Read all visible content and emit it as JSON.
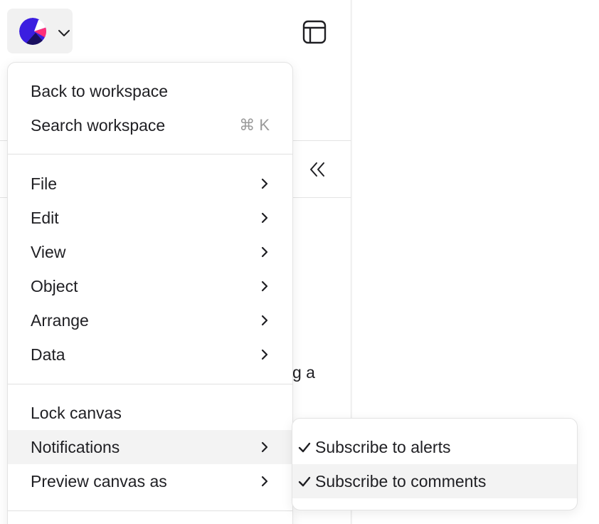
{
  "header": {
    "logo_icon": "canva-style-logo-icon",
    "logo_colors": [
      "#3b1ee0",
      "#1a1060",
      "#ff2f7a"
    ],
    "dropdown_icon": "chevron-down-icon",
    "layout_icon": "layout-panel-icon",
    "collapse_icon": "double-chevron-left-icon"
  },
  "background_text": "g a",
  "menu": {
    "group1": [
      {
        "label": "Back to workspace",
        "shortcut": ""
      },
      {
        "label": "Search workspace",
        "shortcut": "⌘ K"
      }
    ],
    "group2": [
      {
        "label": "File"
      },
      {
        "label": "Edit"
      },
      {
        "label": "View"
      },
      {
        "label": "Object"
      },
      {
        "label": "Arrange"
      },
      {
        "label": "Data"
      }
    ],
    "group3": [
      {
        "label": "Lock canvas",
        "has_submenu": false
      },
      {
        "label": "Notifications",
        "has_submenu": true,
        "active": true
      },
      {
        "label": "Preview canvas as",
        "has_submenu": true
      }
    ]
  },
  "submenu": {
    "items": [
      {
        "label": "Subscribe to alerts",
        "checked": true
      },
      {
        "label": "Subscribe to comments",
        "checked": true,
        "hovered": true
      }
    ]
  }
}
